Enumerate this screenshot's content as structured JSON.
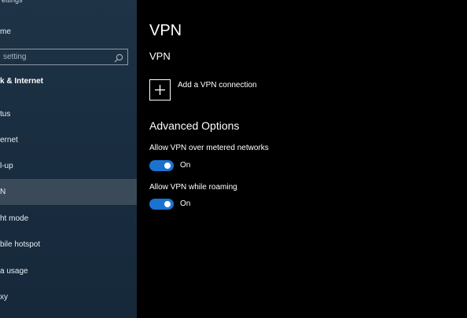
{
  "sidebar": {
    "title": "ettings",
    "home_label": "me",
    "search": {
      "placeholder": "setting"
    },
    "section_heading": "k & Internet",
    "items": [
      {
        "label": "tus",
        "selected": false
      },
      {
        "label": "ernet",
        "selected": false
      },
      {
        "label": "l-up",
        "selected": false
      },
      {
        "label": "N",
        "selected": true
      },
      {
        "label": "ht mode",
        "selected": false
      },
      {
        "label": "bile hotspot",
        "selected": false
      },
      {
        "label": "a usage",
        "selected": false
      },
      {
        "label": "xy",
        "selected": false
      }
    ]
  },
  "main": {
    "title": "VPN",
    "vpn_heading": "VPN",
    "add_vpn_label": "Add a VPN connection",
    "advanced_heading": "Advanced Options",
    "options": [
      {
        "label": "Allow VPN over metered networks",
        "state": "On"
      },
      {
        "label": "Allow VPN while roaming",
        "state": "On"
      }
    ]
  },
  "colors": {
    "accent": "#1a73d1",
    "sidebar_bg": "#1c3044",
    "selected_bg": "#3a4a59",
    "main_bg": "#000000"
  },
  "icons": [
    "search-icon",
    "plus-icon"
  ]
}
